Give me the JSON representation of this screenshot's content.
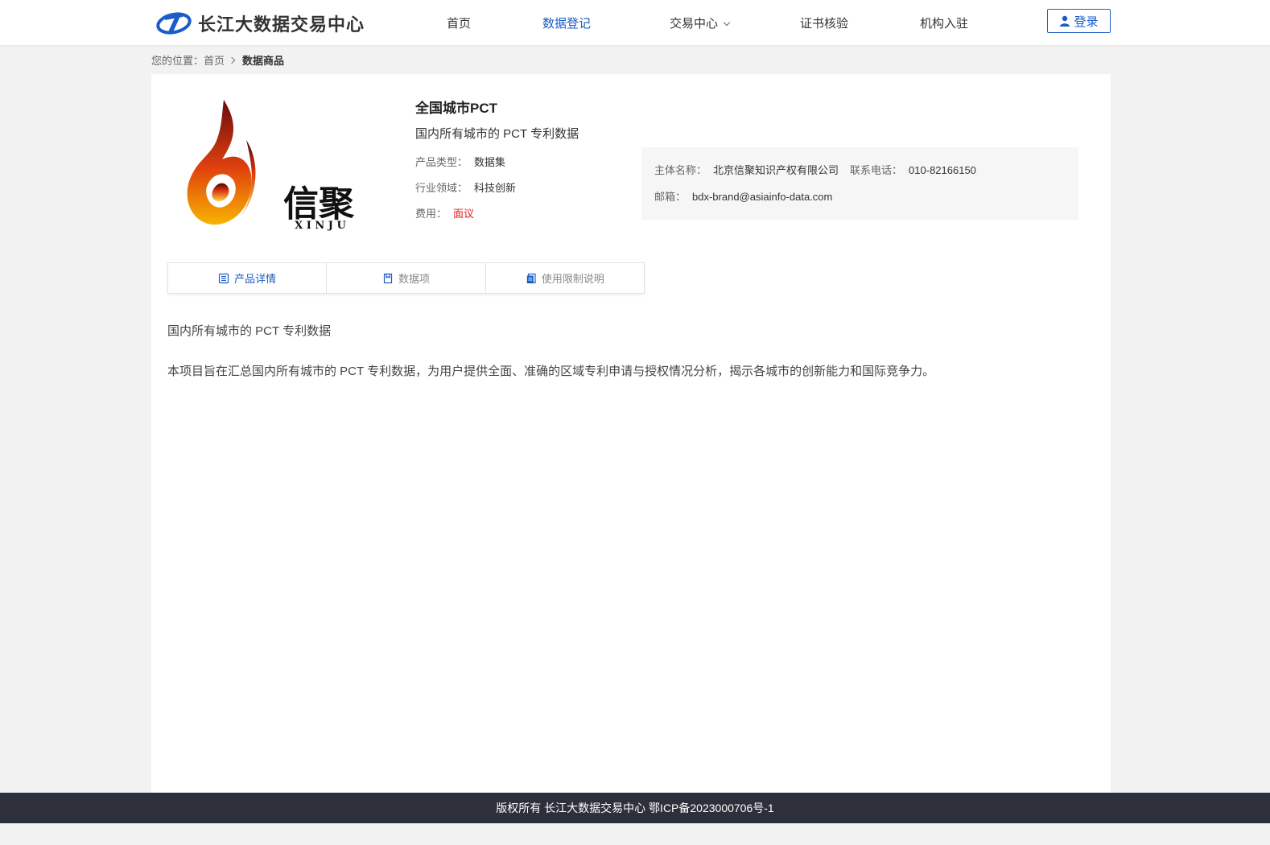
{
  "header": {
    "brand_name": "长江大数据交易中心",
    "nav": [
      {
        "label": "首页"
      },
      {
        "label": "数据登记"
      },
      {
        "label": "交易中心"
      },
      {
        "label": "证书核验"
      },
      {
        "label": "机构入驻"
      }
    ],
    "login_label": "登录"
  },
  "breadcrumb": {
    "prefix": "您的位置：",
    "home": "首页",
    "current": "数据商品"
  },
  "product": {
    "logo_text_cn": "信聚",
    "logo_text_en": "X I N J U",
    "title": "全国城市PCT",
    "subtitle": "国内所有城市的 PCT 专利数据",
    "type_label": "产品类型：",
    "type_value": "数据集",
    "industry_label": "行业领域：",
    "industry_value": "科技创新",
    "fee_label": "费用：",
    "fee_value": "面议"
  },
  "contact": {
    "entity_label": "主体名称：",
    "entity_value": "北京信聚知识产权有限公司",
    "phone_label": "联系电话：",
    "phone_value": "010-82166150",
    "email_label": "邮箱：",
    "email_value": "bdx-brand@asiainfo-data.com"
  },
  "tabs": [
    {
      "label": "产品详情"
    },
    {
      "label": "数据项"
    },
    {
      "label": "使用限制说明"
    }
  ],
  "description": {
    "line1": "国内所有城市的 PCT 专利数据",
    "line2": "本项目旨在汇总国内所有城市的 PCT 专利数据，为用户提供全面、准确的区域专利申请与授权情况分析，揭示各城市的创新能力和国际竞争力。"
  },
  "footer": {
    "text": "版权所有 长江大数据交易中心 鄂ICP备2023000706号-1"
  },
  "colors": {
    "accent": "#1a5cc8",
    "fee": "#e02020",
    "footer_bg": "#2d2f3b"
  }
}
